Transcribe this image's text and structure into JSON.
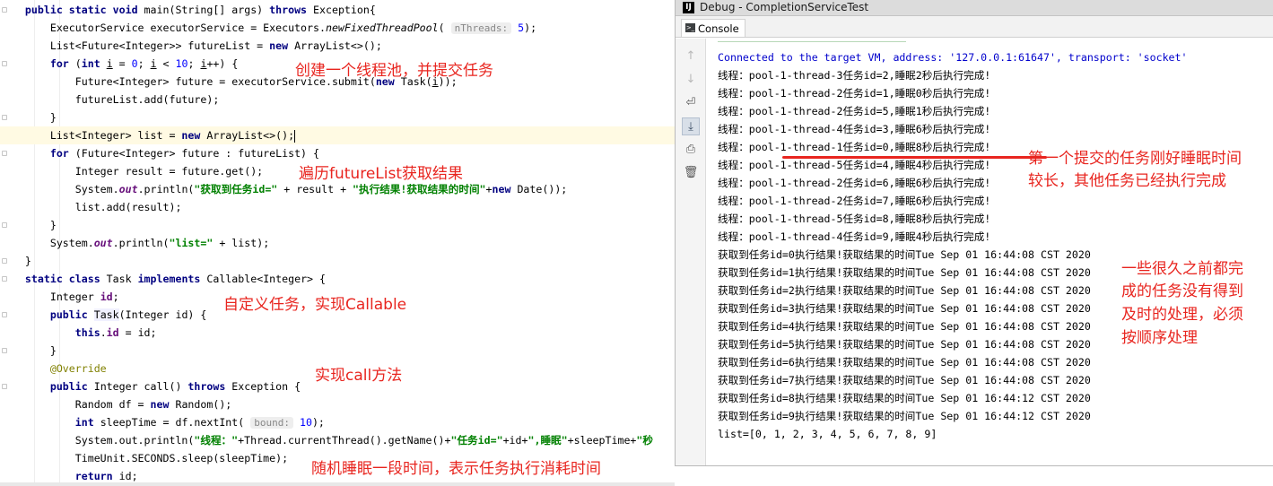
{
  "colors": {
    "keyword": "#000080",
    "number": "#0000ff",
    "string": "#008000",
    "field": "#660e7a",
    "annotation_red": "#e8251f",
    "console_blue": "#0000cc",
    "current_line": "#fffae3"
  },
  "editor": {
    "hints": {
      "nthreads": "nThreads:",
      "bound": "bound:"
    },
    "annotations": {
      "create_pool": "创建一个线程池，并提交任务",
      "traverse": "遍历futureList获取结果",
      "custom_task": "自定义任务，实现Callable",
      "impl_call": "实现call方法",
      "random_sleep": "随机睡眠一段时间，表示任务执行消耗时间"
    }
  },
  "debug": {
    "title": "Debug - CompletionServiceTest",
    "logo": "IJ",
    "tab_console": "Console",
    "toolbar_icons": [
      "arrow-up-icon",
      "arrow-down-icon",
      "soft-wrap-icon",
      "scroll-to-end-icon",
      "print-icon",
      "trash-icon"
    ],
    "console_lines": [
      "Connected to the target VM, address: '127.0.0.1:61647', transport: 'socket'",
      "线程：pool-1-thread-3任务id=2,睡眠2秒后执行完成!",
      "线程：pool-1-thread-2任务id=1,睡眠0秒后执行完成!",
      "线程：pool-1-thread-2任务id=5,睡眠1秒后执行完成!",
      "线程：pool-1-thread-4任务id=3,睡眠6秒后执行完成!",
      "线程：pool-1-thread-1任务id=0,睡眠8秒后执行完成!",
      "线程：pool-1-thread-5任务id=4,睡眠4秒后执行完成!",
      "线程：pool-1-thread-2任务id=6,睡眠6秒后执行完成!",
      "线程：pool-1-thread-2任务id=7,睡眠6秒后执行完成!",
      "线程：pool-1-thread-5任务id=8,睡眠8秒后执行完成!",
      "线程：pool-1-thread-4任务id=9,睡眠4秒后执行完成!",
      "获取到任务id=0执行结果!获取结果的时间Tue Sep 01 16:44:08 CST 2020",
      "获取到任务id=1执行结果!获取结果的时间Tue Sep 01 16:44:08 CST 2020",
      "获取到任务id=2执行结果!获取结果的时间Tue Sep 01 16:44:08 CST 2020",
      "获取到任务id=3执行结果!获取结果的时间Tue Sep 01 16:44:08 CST 2020",
      "获取到任务id=4执行结果!获取结果的时间Tue Sep 01 16:44:08 CST 2020",
      "获取到任务id=5执行结果!获取结果的时间Tue Sep 01 16:44:08 CST 2020",
      "获取到任务id=6执行结果!获取结果的时间Tue Sep 01 16:44:08 CST 2020",
      "获取到任务id=7执行结果!获取结果的时间Tue Sep 01 16:44:08 CST 2020",
      "获取到任务id=8执行结果!获取结果的时间Tue Sep 01 16:44:12 CST 2020",
      "获取到任务id=9执行结果!获取结果的时间Tue Sep 01 16:44:12 CST 2020",
      "list=[0, 1, 2, 3, 4, 5, 6, 7, 8, 9]"
    ],
    "annotations": {
      "first_task_1": "第一个提交的任务刚好睡眠时间",
      "first_task_2": "较长，其他任务已经执行完成",
      "long_ago_1": "一些很久之前都完",
      "long_ago_2": "成的任务没有得到",
      "long_ago_3": "及时的处理，必须",
      "long_ago_4": "按顺序处理"
    }
  }
}
